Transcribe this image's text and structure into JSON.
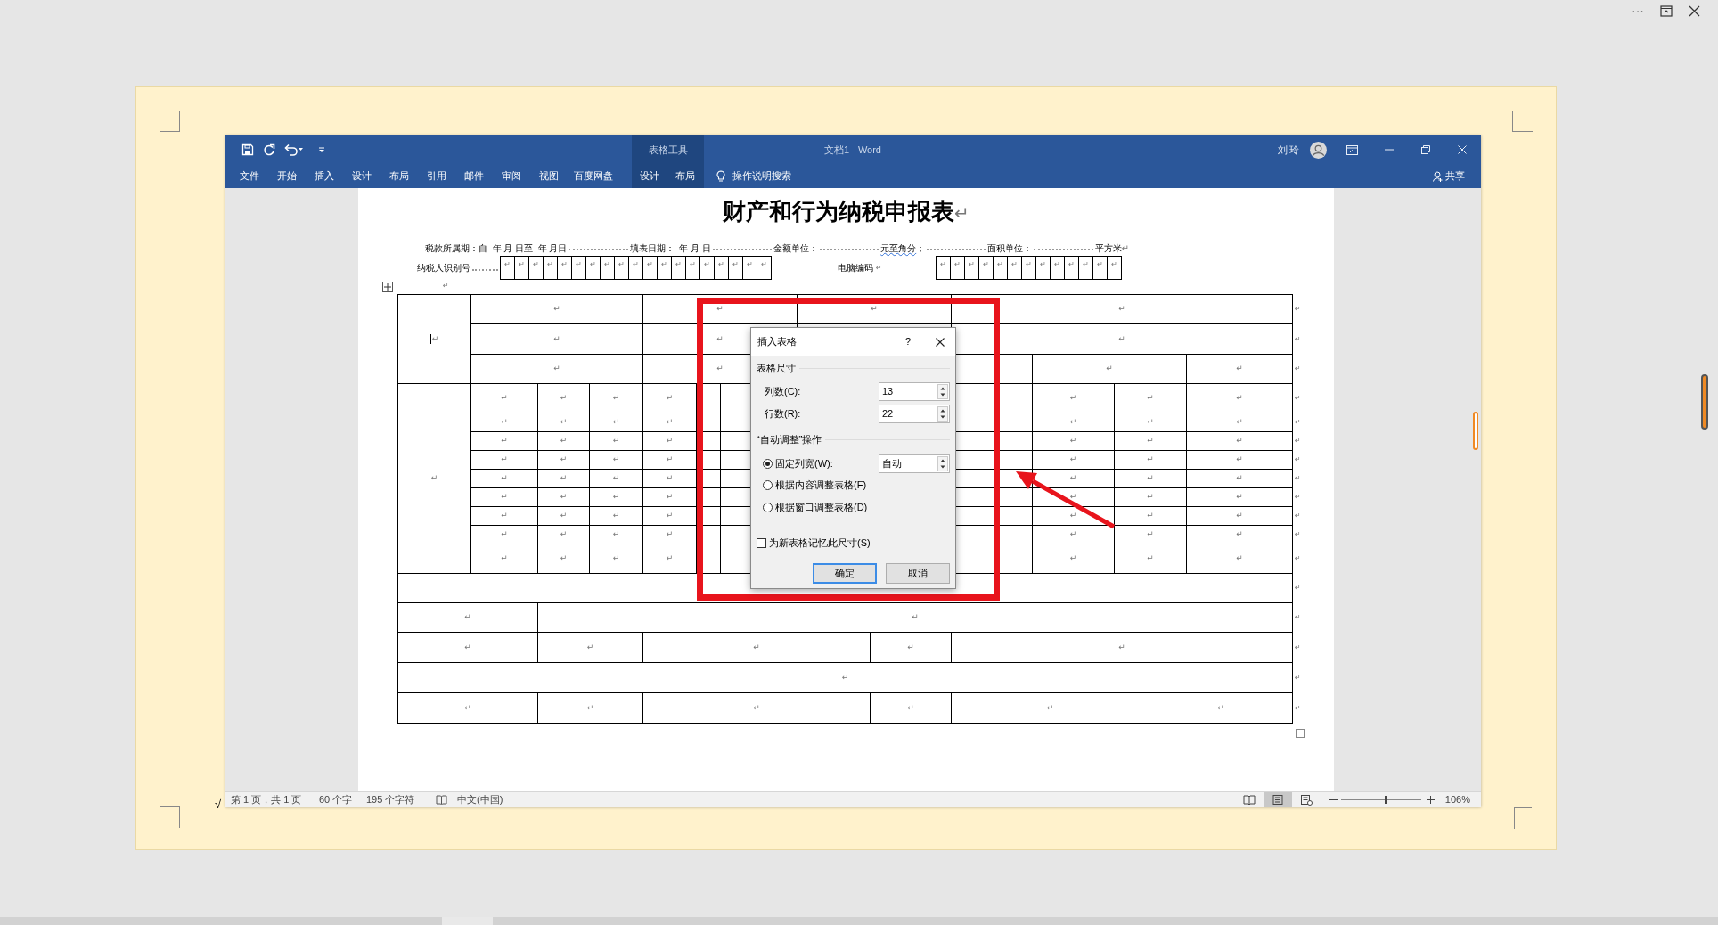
{
  "viewer": {
    "more": "···",
    "check": "√"
  },
  "word": {
    "context_header": "表格工具",
    "title": "文档1 - Word",
    "user": "刘玲",
    "tabs": [
      {
        "label": "文件",
        "contextual": false
      },
      {
        "label": "开始",
        "contextual": false
      },
      {
        "label": "插入",
        "contextual": false
      },
      {
        "label": "设计",
        "contextual": false
      },
      {
        "label": "布局",
        "contextual": false
      },
      {
        "label": "引用",
        "contextual": false
      },
      {
        "label": "邮件",
        "contextual": false
      },
      {
        "label": "审阅",
        "contextual": false
      },
      {
        "label": "视图",
        "contextual": false
      },
      {
        "label": "百度网盘",
        "contextual": false
      },
      {
        "label": "设计",
        "contextual": true
      },
      {
        "label": "布局",
        "contextual": true
      }
    ],
    "search": "操作说明搜索",
    "share": "共享"
  },
  "document": {
    "title": "财产和行为纳税申报表",
    "title_mark": "↵",
    "header_line": [
      {
        "text": "税款所属期：自  年 月 日至  年 月日",
        "kind": "label",
        "leader": false
      },
      {
        "text": "填表日期：  年 月 日",
        "kind": "label",
        "leader": true
      },
      {
        "text": "金额单位：",
        "kind": "label",
        "leader": true
      },
      {
        "text": "元至角分",
        "kind": "proofing",
        "leader": true
      },
      {
        "text": "；",
        "kind": "label",
        "leader": false
      },
      {
        "text": "面积单位：",
        "kind": "label",
        "leader": true
      },
      {
        "text": "平方米",
        "kind": "label",
        "leader": true
      },
      {
        "text": "↵",
        "kind": "mark",
        "leader": false
      }
    ],
    "id_label": "纳税人识别号",
    "id_boxes": [
      "↵",
      "↵",
      "↵",
      "↵",
      "↵",
      "↵",
      "↵",
      "↵",
      "↵",
      "↵",
      "↵",
      "↵",
      "↵",
      "↵",
      "↵",
      "↵",
      "↵",
      "↵",
      "↵"
    ],
    "code_label": "电脑编码",
    "code_mark": "↵",
    "code_boxes": [
      "↵",
      "↵",
      "↵",
      "↵",
      "↵",
      "↵",
      "↵",
      "↵",
      "↵",
      "↵",
      "↵",
      "↵",
      "↵"
    ],
    "paragraph_mark": "↵"
  },
  "table": {
    "rows": [
      {
        "cells": [
          "↵",
          "↵",
          "↵",
          "↵",
          "↵"
        ],
        "end": "↵"
      },
      {
        "cells": [
          "↵",
          "↵",
          "↵"
        ],
        "end": "↵"
      },
      {
        "cells": [
          "↵",
          "↵",
          "↵",
          "↵"
        ],
        "end": "↵"
      },
      {
        "cells": [
          "↵",
          "↵",
          "↵",
          "↵",
          "↵",
          "↵",
          "↵",
          "↵"
        ],
        "end": "↵"
      },
      {
        "cells": [
          "↵",
          "↵",
          "↵",
          "↵",
          "↵",
          "↵",
          "↵"
        ],
        "end": "↵"
      },
      {
        "cells": [
          "↵",
          "↵",
          "↵",
          "↵",
          "↵",
          "↵",
          "↵"
        ],
        "end": "↵"
      },
      {
        "cells": [
          "↵",
          "↵",
          "↵",
          "↵",
          "↵",
          "↵",
          "↵"
        ],
        "end": "↵"
      },
      {
        "cells": [
          "↵",
          "↵",
          "↵",
          "↵",
          "↵",
          "↵",
          "↵"
        ],
        "end": "↵"
      },
      {
        "cells": [
          "↵",
          "↵",
          "↵",
          "↵",
          "↵",
          "↵",
          "↵"
        ],
        "end": "↵"
      },
      {
        "cells": [
          "↵",
          "↵",
          "↵",
          "↵",
          "↵",
          "↵",
          "↵"
        ],
        "end": "↵"
      },
      {
        "cells": [
          "↵",
          "↵",
          "↵",
          "↵",
          "↵",
          "↵",
          "↵"
        ],
        "end": "↵"
      },
      {
        "cells": [
          "↵",
          "↵",
          "↵",
          "↵",
          "↵",
          "↵",
          "↵"
        ],
        "end": "↵"
      },
      {
        "end": "↵"
      },
      {
        "cells": [
          "↵",
          "↵"
        ],
        "end": "↵"
      },
      {
        "cells": [
          "↵",
          "↵",
          "↵",
          "↵",
          "↵"
        ],
        "end": "↵"
      },
      {
        "cells": [
          "↵"
        ],
        "end": "↵"
      },
      {
        "cells": [
          "↵",
          "↵",
          "↵",
          "↵",
          "↵",
          "↵"
        ],
        "end": "↵"
      }
    ]
  },
  "dialog": {
    "title": "插入表格",
    "help": "?",
    "section_size": "表格尺寸",
    "fields": [
      {
        "label": "列数(C):",
        "value": "13"
      },
      {
        "label": "行数(R):",
        "value": "22"
      }
    ],
    "section_autofit": "“自动调整”操作",
    "options": [
      {
        "label": "固定列宽(W):",
        "selected": true,
        "value": "自动"
      },
      {
        "label": "根据内容调整表格(F)",
        "selected": false
      },
      {
        "label": "根据窗口调整表格(D)",
        "selected": false
      }
    ],
    "remember": {
      "label": "为新表格记忆此尺寸(S)",
      "checked": false
    },
    "buttons": [
      {
        "label": "确定",
        "default": true
      },
      {
        "label": "取消",
        "default": false
      }
    ]
  },
  "status_bar": {
    "page": "第 1 页，共 1 页",
    "words": "60 个字",
    "chars": "195 个字符",
    "language": "中文(中国)",
    "views": [
      {
        "kind": "read",
        "selected": false
      },
      {
        "kind": "print",
        "selected": true
      },
      {
        "kind": "web",
        "selected": false
      }
    ],
    "zoom_slider": {
      "level": 0.55
    },
    "zoom": "106%"
  }
}
